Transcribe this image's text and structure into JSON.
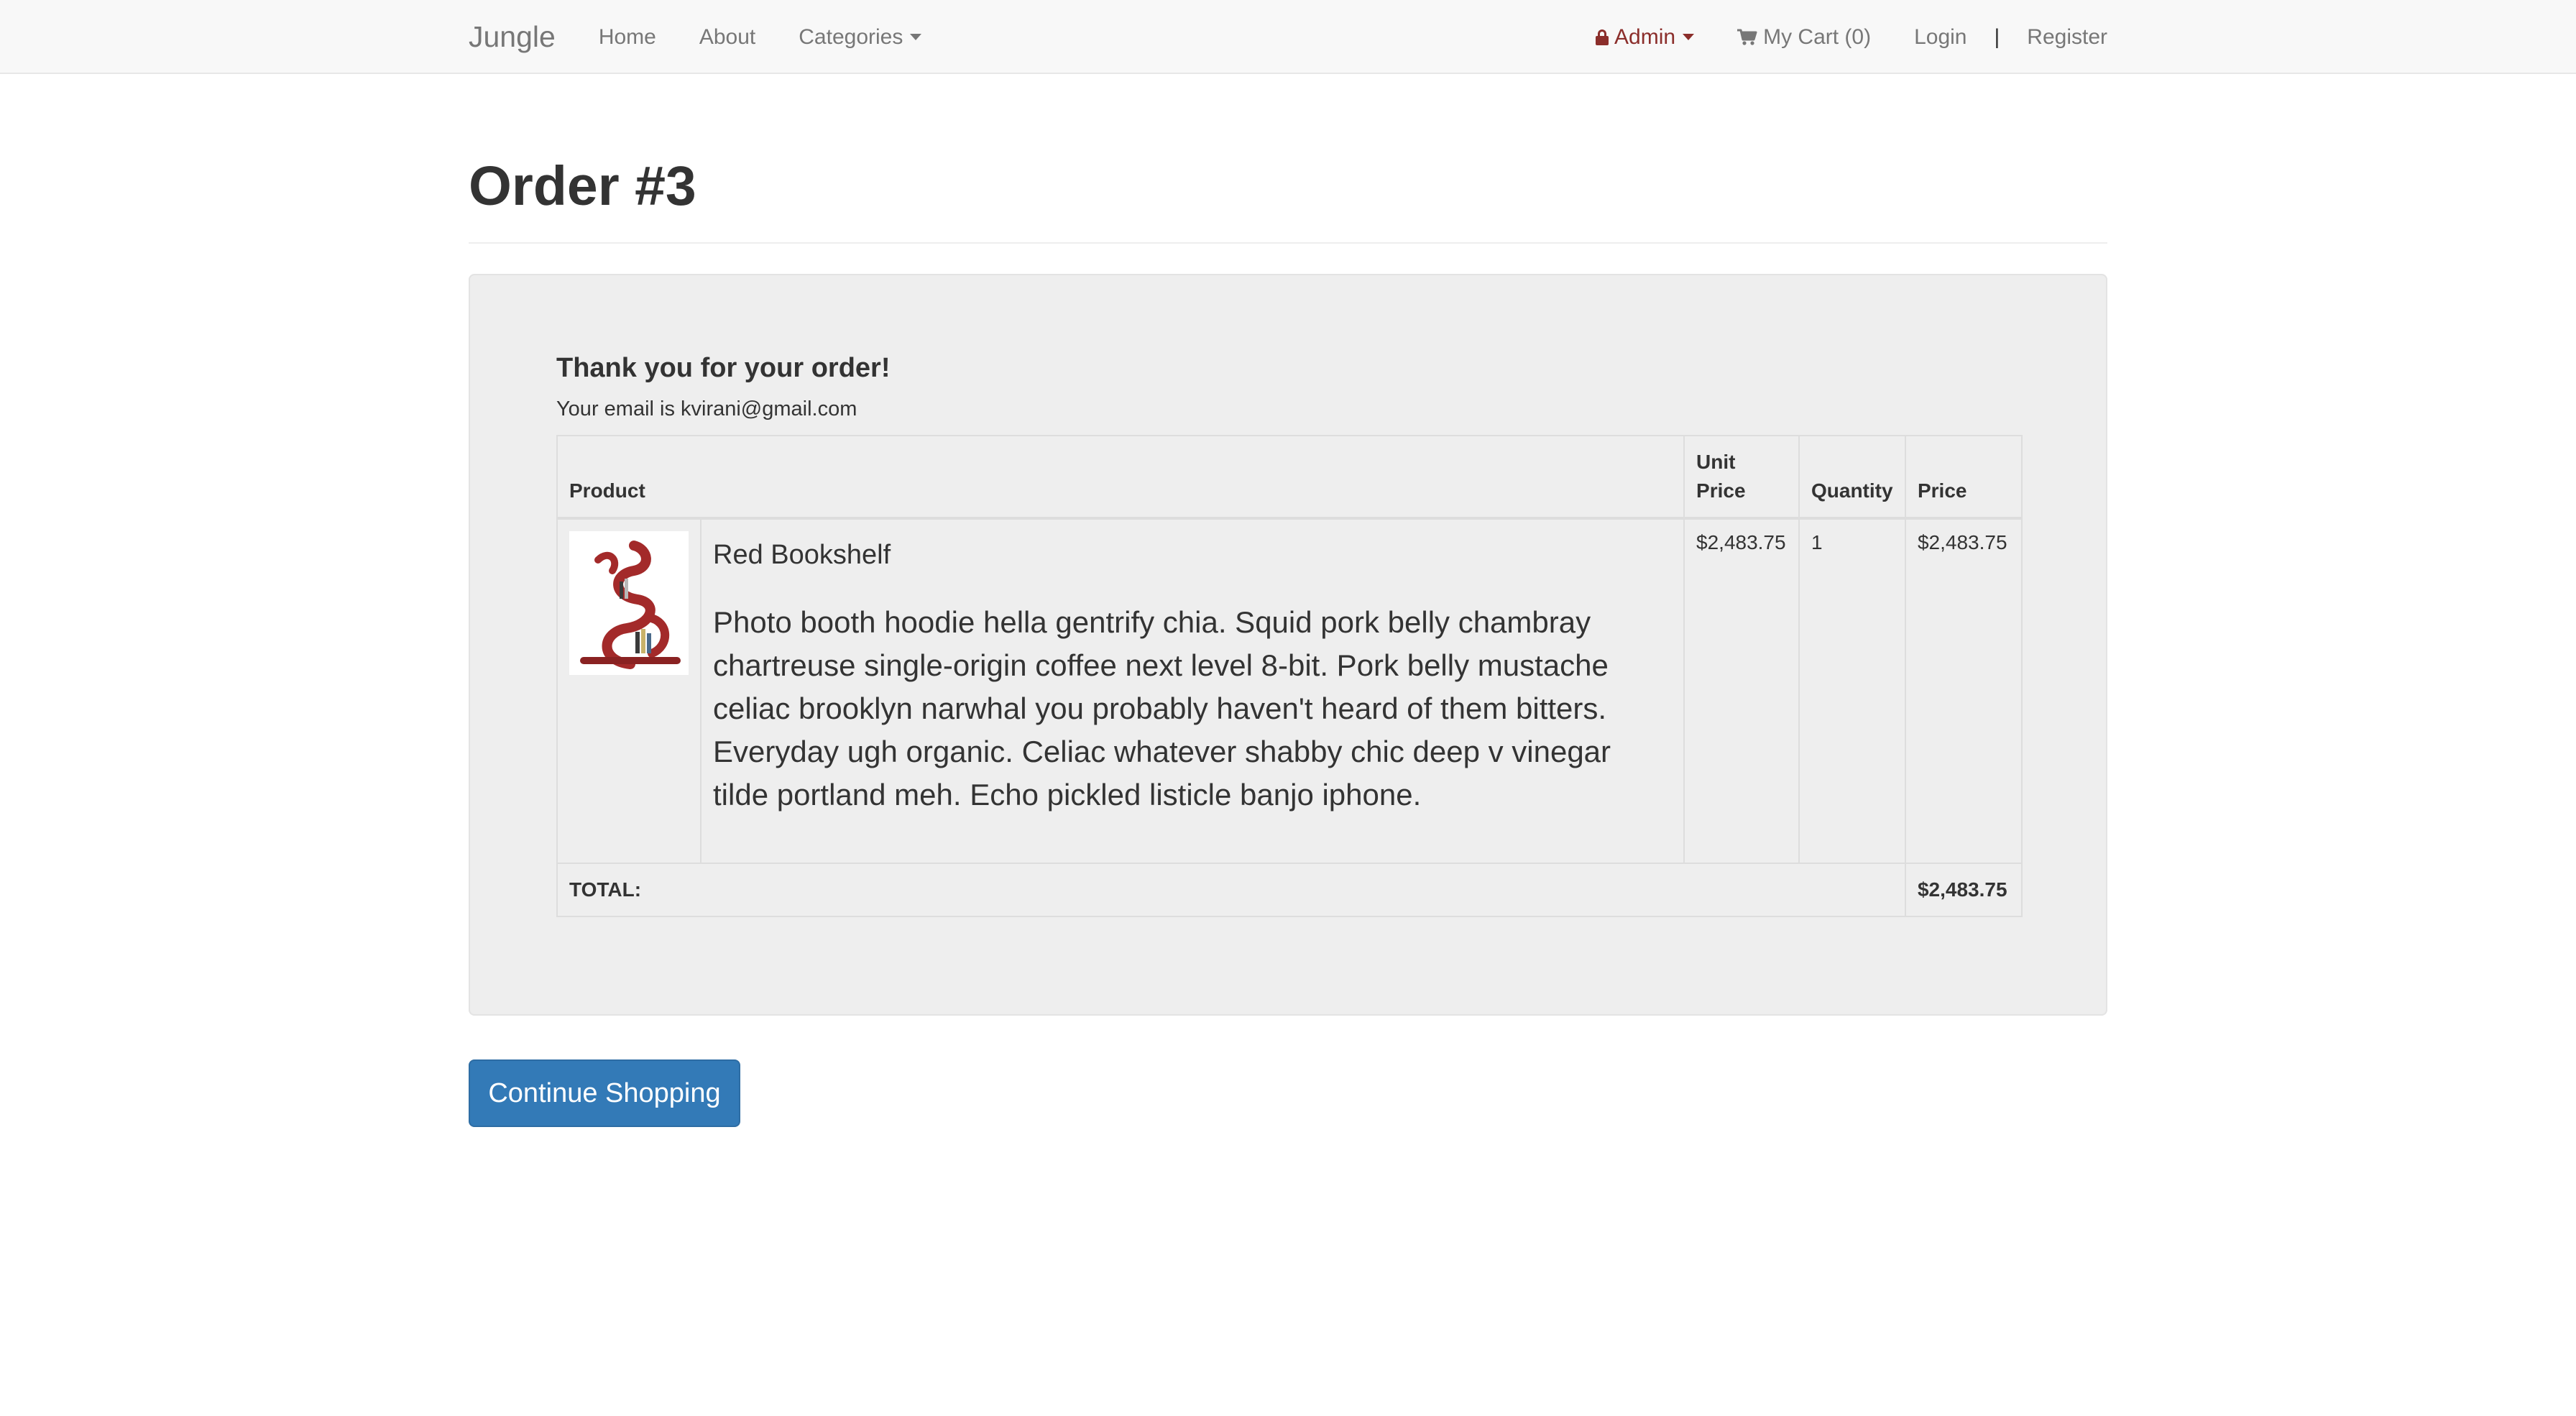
{
  "navbar": {
    "brand": "Jungle",
    "links": {
      "home": "Home",
      "about": "About",
      "categories": "Categories"
    },
    "admin": "Admin",
    "cart": "My Cart (0)",
    "login": "Login",
    "separator": "|",
    "register": "Register"
  },
  "page": {
    "title": "Order #3"
  },
  "order": {
    "thanks": "Thank you for your order!",
    "email_line": "Your email is kvirani@gmail.com",
    "headers": {
      "product": "Product",
      "unit_price": "Unit Price",
      "quantity": "Quantity",
      "price": "Price"
    },
    "items": [
      {
        "name": "Red Bookshelf",
        "description": "Photo booth hoodie hella gentrify chia. Squid pork belly chambray chartreuse single-origin coffee next level 8-bit. Pork belly mustache celiac brooklyn narwhal you probably haven't heard of them bitters. Everyday ugh organic. Celiac whatever shabby chic deep v vinegar tilde portland meh. Echo pickled listicle banjo iphone.",
        "unit_price": "$2,483.75",
        "quantity": "1",
        "price": "$2,483.75"
      }
    ],
    "total_label": "TOTAL:",
    "total_value": "$2,483.75"
  },
  "actions": {
    "continue_label": "Continue Shopping"
  },
  "colors": {
    "primary": "#337ab7",
    "admin": "#8b2e2b",
    "navbar_bg": "#f8f8f8",
    "well_bg": "#eeeeee"
  },
  "icons": {
    "lock": "lock-icon",
    "cart": "cart-icon",
    "caret": "caret-down-icon"
  }
}
